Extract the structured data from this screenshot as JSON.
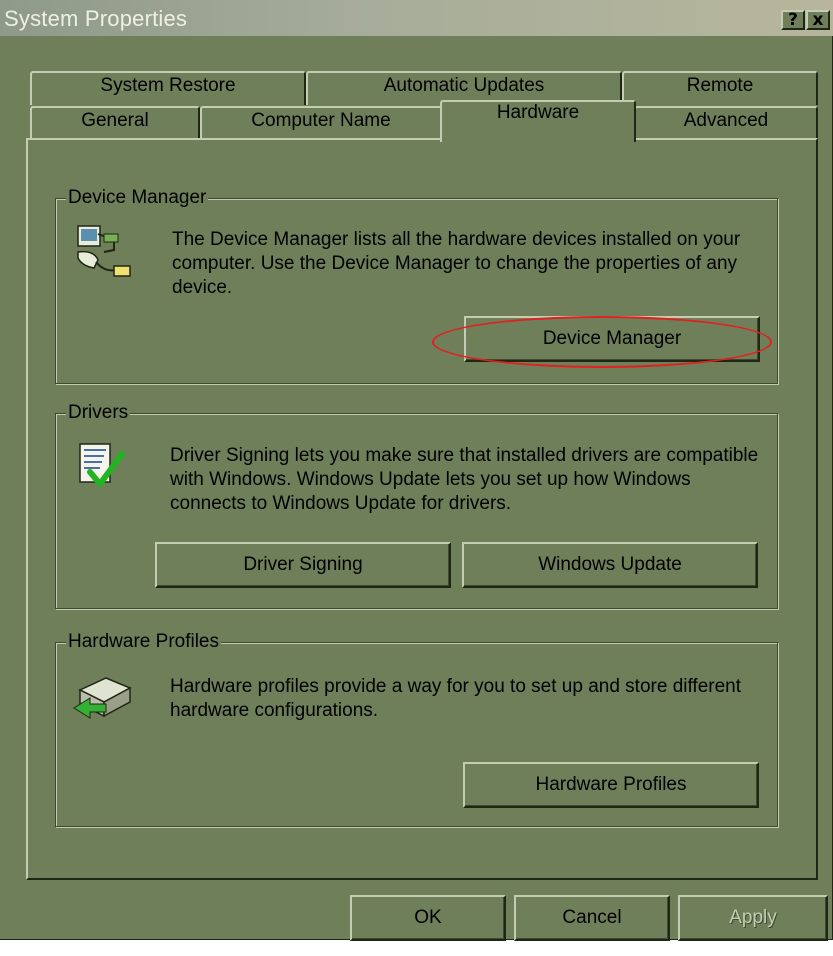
{
  "window": {
    "title": "System Properties",
    "help_label": "?",
    "close_label": "x"
  },
  "tabs": {
    "row1": [
      {
        "label": "System Restore"
      },
      {
        "label": "Automatic Updates"
      },
      {
        "label": "Remote"
      }
    ],
    "row2": [
      {
        "label": "General"
      },
      {
        "label": "Computer Name"
      },
      {
        "label": "Hardware",
        "selected": true
      },
      {
        "label": "Advanced"
      }
    ]
  },
  "device_manager": {
    "legend": "Device Manager",
    "description": "The Device Manager lists all the hardware devices installed on your computer. Use the Device Manager to change the properties of any device.",
    "button": "Device Manager",
    "highlight_color": "#e2201f"
  },
  "drivers": {
    "legend": "Drivers",
    "description": "Driver Signing lets you make sure that installed drivers are compatible with Windows. Windows Update lets you set up how Windows connects to Windows Update for drivers.",
    "signing_button": "Driver Signing",
    "update_button": "Windows Update"
  },
  "hardware_profiles": {
    "legend": "Hardware Profiles",
    "description": "Hardware profiles provide a way for you to set up and store different hardware configurations.",
    "button": "Hardware Profiles"
  },
  "footer": {
    "ok": "OK",
    "cancel": "Cancel",
    "apply": "Apply"
  },
  "icons": {
    "device_manager": "device-manager-icon",
    "drivers": "driver-signing-icon",
    "hardware_profiles": "hardware-profiles-icon"
  },
  "colors": {
    "face": "#6e7f5a",
    "highlight": "#c4ccb2",
    "shadow": "#1e2614"
  }
}
